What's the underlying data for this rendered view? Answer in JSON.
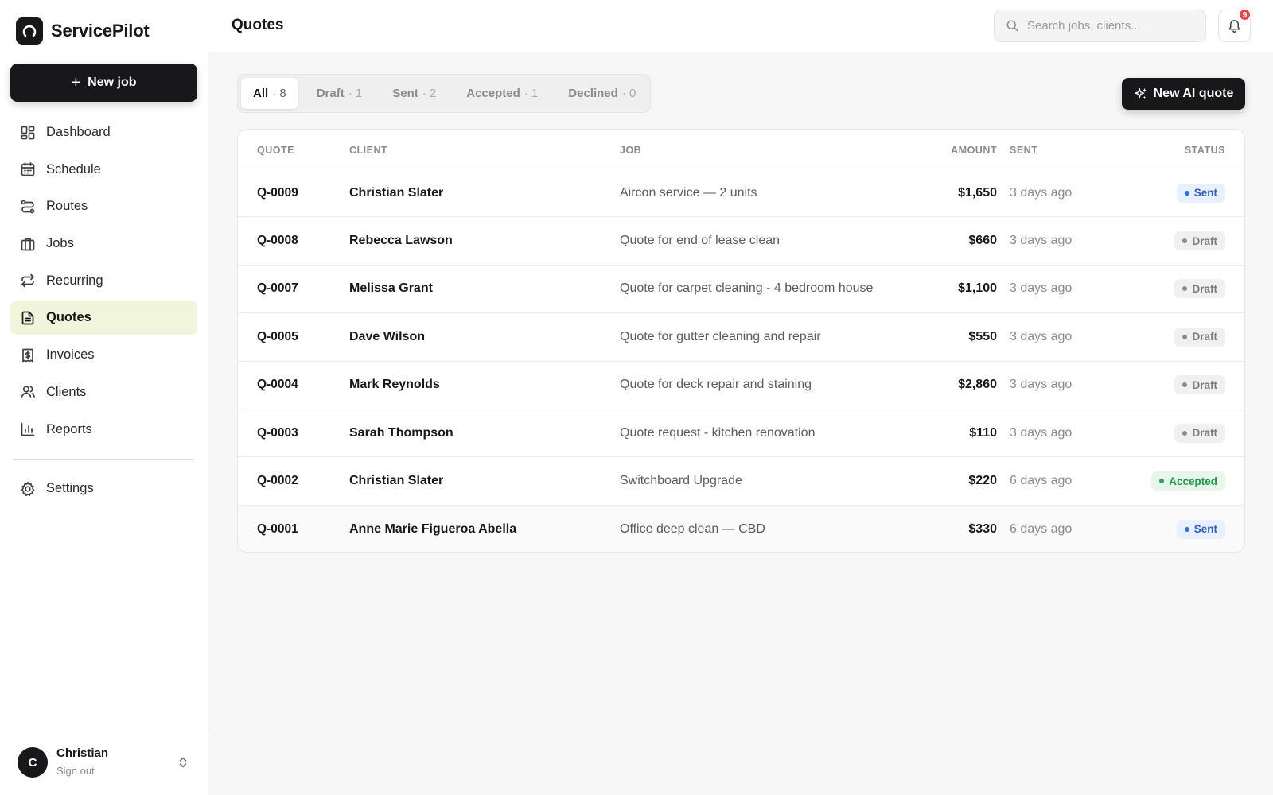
{
  "brand": {
    "name": "ServicePilot"
  },
  "sidebar": {
    "new_job_label": "New job",
    "items": [
      {
        "label": "Dashboard",
        "icon": "dashboard-icon"
      },
      {
        "label": "Schedule",
        "icon": "calendar-icon"
      },
      {
        "label": "Routes",
        "icon": "route-icon"
      },
      {
        "label": "Jobs",
        "icon": "briefcase-icon"
      },
      {
        "label": "Recurring",
        "icon": "repeat-icon"
      },
      {
        "label": "Quotes",
        "icon": "document-icon",
        "active": true
      },
      {
        "label": "Invoices",
        "icon": "invoice-icon"
      },
      {
        "label": "Clients",
        "icon": "users-icon"
      },
      {
        "label": "Reports",
        "icon": "bar-chart-icon"
      }
    ],
    "settings_label": "Settings",
    "user": {
      "initial": "C",
      "name": "Christian",
      "signout": "Sign out"
    }
  },
  "header": {
    "title": "Quotes",
    "search_placeholder": "Search jobs, clients...",
    "notification_count": "9"
  },
  "filters": [
    {
      "label": "All",
      "count": "· 8",
      "active": true
    },
    {
      "label": "Draft",
      "count": "· 1"
    },
    {
      "label": "Sent",
      "count": "· 2"
    },
    {
      "label": "Accepted",
      "count": "· 1"
    },
    {
      "label": "Declined",
      "count": "· 0"
    }
  ],
  "ai_quote_label": "New AI quote",
  "table": {
    "columns": {
      "quote": "QUOTE",
      "client": "CLIENT",
      "job": "JOB",
      "amount": "AMOUNT",
      "sent": "SENT",
      "status": "STATUS"
    },
    "rows": [
      {
        "quote": "Q-0009",
        "client": "Christian Slater",
        "job": "Aircon service — 2 units",
        "amount": "$1,650",
        "sent": "3 days ago",
        "status": "Sent",
        "status_key": "sent"
      },
      {
        "quote": "Q-0008",
        "client": "Rebecca Lawson",
        "job": "Quote for end of lease clean",
        "amount": "$660",
        "sent": "3 days ago",
        "status": "Draft",
        "status_key": "draft"
      },
      {
        "quote": "Q-0007",
        "client": "Melissa Grant",
        "job": "Quote for carpet cleaning - 4 bedroom house",
        "amount": "$1,100",
        "sent": "3 days ago",
        "status": "Draft",
        "status_key": "draft"
      },
      {
        "quote": "Q-0005",
        "client": "Dave Wilson",
        "job": "Quote for gutter cleaning and repair",
        "amount": "$550",
        "sent": "3 days ago",
        "status": "Draft",
        "status_key": "draft"
      },
      {
        "quote": "Q-0004",
        "client": "Mark Reynolds",
        "job": "Quote for deck repair and staining",
        "amount": "$2,860",
        "sent": "3 days ago",
        "status": "Draft",
        "status_key": "draft"
      },
      {
        "quote": "Q-0003",
        "client": "Sarah Thompson",
        "job": "Quote request - kitchen renovation",
        "amount": "$110",
        "sent": "3 days ago",
        "status": "Draft",
        "status_key": "draft"
      },
      {
        "quote": "Q-0002",
        "client": "Christian Slater",
        "job": "Switchboard Upgrade",
        "amount": "$220",
        "sent": "6 days ago",
        "status": "Accepted",
        "status_key": "accepted"
      },
      {
        "quote": "Q-0001",
        "client": "Anne Marie Figueroa Abella",
        "job": "Office deep clean — CBD",
        "amount": "$330",
        "sent": "6 days ago",
        "status": "Sent",
        "status_key": "sent"
      }
    ]
  },
  "colors": {
    "accent": "#18181b",
    "active_nav_bg": "#f1f5dc",
    "sent": "#2f6fe0",
    "accepted": "#22a552",
    "draft": "#8a8a92",
    "badge_red": "#ef4444"
  }
}
